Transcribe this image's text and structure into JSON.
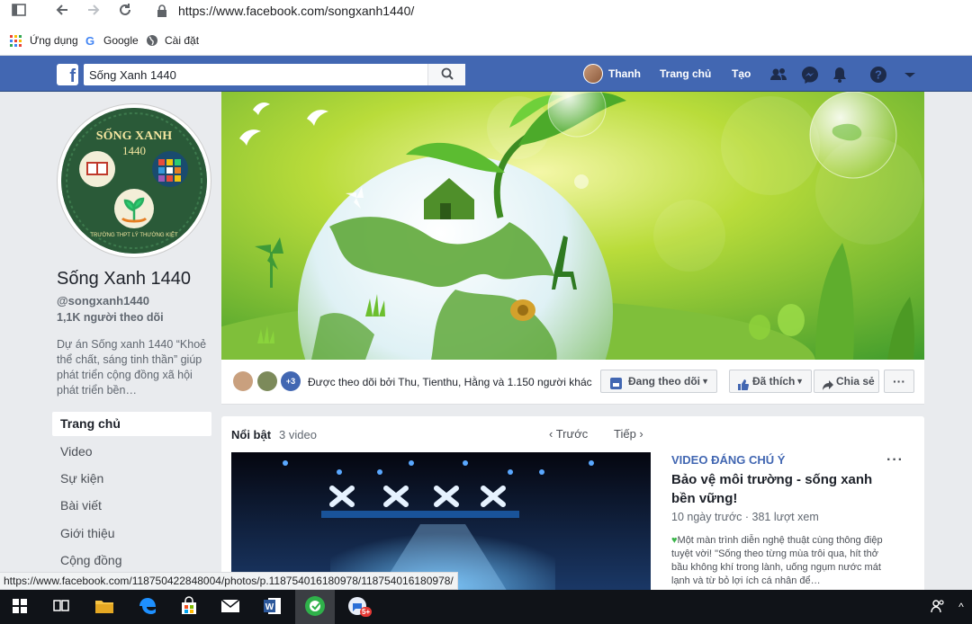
{
  "browser": {
    "url": "https://www.facebook.com/songxanh1440/",
    "bookmarks": [
      {
        "label": "Ứng dụng",
        "icon": "apps-grid-icon"
      },
      {
        "label": "Google",
        "icon": "google-icon"
      },
      {
        "label": "Cài đặt",
        "icon": "settings-globe-icon"
      }
    ],
    "status_url": "https://www.facebook.com/118750422848004/photos/p.118754016180978/118754016180978/"
  },
  "fb_header": {
    "search_value": "Sống Xanh 1440",
    "user_name": "Thanh",
    "home_label": "Trang chủ",
    "create_label": "Tạo"
  },
  "page": {
    "name": "Sống Xanh 1440",
    "handle": "@songxanh1440",
    "followers": "1,1K người theo dõi",
    "about": "Dự án Sống xanh 1440 “Khoẻ thể chất, sáng tinh thần” giúp phát triển cộng đồng xã hội phát triển bền…",
    "logo_title": "SỐNG XANH",
    "logo_number": "1440",
    "logo_school": "TRƯỜNG THPT LÝ THƯỜNG KIỆT"
  },
  "side_nav": [
    {
      "label": "Trang chủ",
      "active": true
    },
    {
      "label": "Video",
      "active": false
    },
    {
      "label": "Sự kiện",
      "active": false
    },
    {
      "label": "Bài viết",
      "active": false
    },
    {
      "label": "Giới thiệu",
      "active": false
    },
    {
      "label": "Cộng đồng",
      "active": false
    }
  ],
  "action_bar": {
    "more_count": "+3",
    "followed_by": "Được theo dõi bởi Thu, Tienthu, Hằng và 1.150 người khác",
    "following_label": "Đang theo dõi",
    "liked_label": "Đã thích",
    "share_label": "Chia sẻ",
    "more_label": "···"
  },
  "featured": {
    "title": "Nổi bật",
    "count": "3 video",
    "prev_label": "Trước",
    "next_label": "Tiếp",
    "video_tag": "VIDEO ĐÁNG CHÚ Ý",
    "video_title": "Bảo vệ môi trường - sống xanh bền vững!",
    "video_meta": "10 ngày trước · 381 lượt xem",
    "video_desc": "Một màn trình diễn nghệ thuật cùng thông điệp tuyệt vời! \"Sống theo từng mùa trôi qua, hít thở bầu không khí trong lành, uống ngụm nước mát lạnh và từ bỏ lợi ích cá nhân để…",
    "more_label": "···"
  },
  "colors": {
    "fb_blue": "#4267b2",
    "page_bg": "#e9ebee",
    "taskbar": "#101318"
  }
}
